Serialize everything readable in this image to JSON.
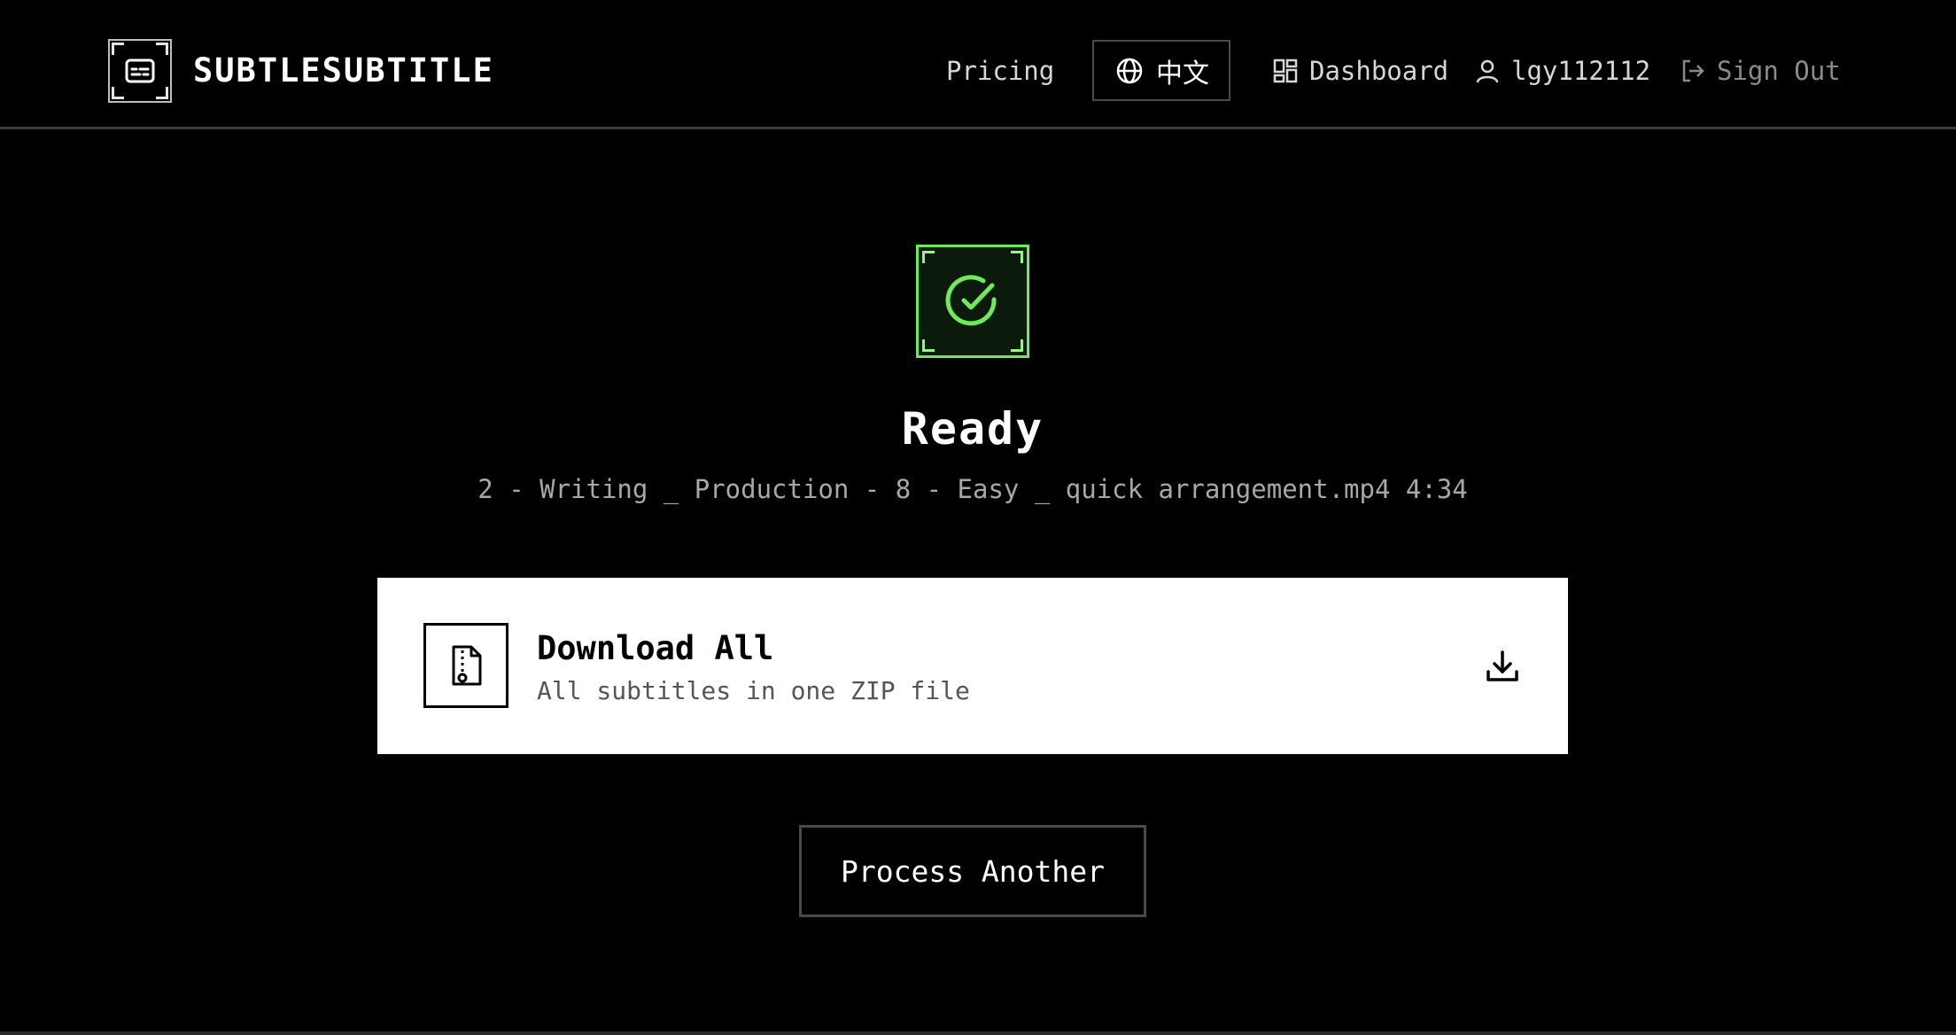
{
  "header": {
    "brand": "SUBTLESUBTITLE",
    "logo_icon": "subtitles-icon",
    "nav": {
      "pricing": "Pricing",
      "language": "中文",
      "language_icon": "globe-icon",
      "dashboard": "Dashboard",
      "dashboard_icon": "grid-icon",
      "username": "lgy112112",
      "user_icon": "user-icon",
      "sign_out": "Sign Out",
      "sign_out_icon": "logout-icon"
    }
  },
  "status": {
    "icon": "check-circle-icon",
    "title": "Ready",
    "file_info": "2 - Writing _ Production - 8 - Easy _ quick arrangement.mp4 4:34"
  },
  "download": {
    "icon": "zip-file-icon",
    "title": "Download All",
    "subtitle": "All subtitles in one ZIP file",
    "action_icon": "download-icon"
  },
  "actions": {
    "process_another": "Process Another"
  },
  "colors": {
    "background": "#000000",
    "accent_green": "#6fea5c",
    "card_background": "#ffffff",
    "muted_text": "#a8a8a8"
  }
}
